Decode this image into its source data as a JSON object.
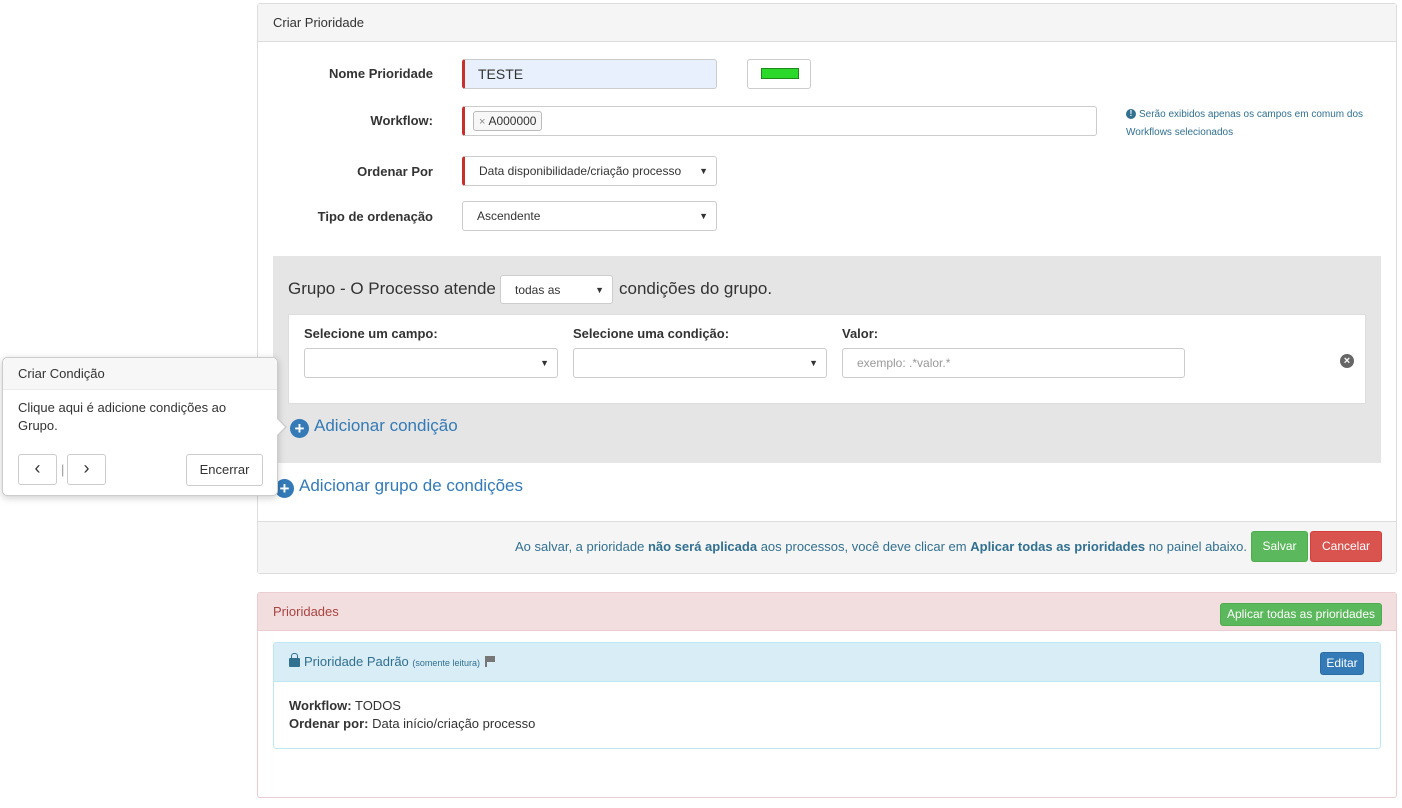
{
  "create_panel": {
    "title": "Criar Prioridade",
    "nome_label": "Nome Prioridade",
    "nome_value": "TESTE",
    "color_value": "#2ad92a",
    "workflow_label": "Workflow:",
    "workflow_tags": [
      "A000000"
    ],
    "workflow_tag_remove": "×",
    "workflow_note": "Serão exibidos apenas os campos em comum dos Workflows selecionados",
    "info_icon_glyph": "!",
    "ordenar_label": "Ordenar Por",
    "ordenar_value": "Data disponibilidade/criação processo",
    "tipo_label": "Tipo de ordenação",
    "tipo_value": "Ascendente",
    "caret_glyph": "▼"
  },
  "group": {
    "prefix": "Grupo - O Processo atende",
    "match_value": "todas as",
    "suffix": "condições do grupo.",
    "campo_label": "Selecione um campo:",
    "campo_value": "",
    "condicao_label": "Selecione uma condição:",
    "condicao_value": "",
    "valor_label": "Valor:",
    "valor_placeholder": "exemplo: .*valor.*",
    "remove_glyph": "×",
    "add_condition": "Adicionar condição",
    "plus_glyph": "+"
  },
  "add_group": "Adicionar grupo de condições",
  "footer": {
    "text_part1": "Ao salvar, a prioridade ",
    "text_bold1": "não será aplicada",
    "text_part2": " aos processos, você deve clicar em ",
    "text_bold2": "Aplicar todas as prioridades",
    "text_part3": " no painel abaixo.",
    "save": "Salvar",
    "cancel": "Cancelar"
  },
  "prioridades": {
    "title": "Prioridades",
    "apply_all": "Aplicar todas as prioridades",
    "item": {
      "name": "Prioridade Padrão",
      "readonly": "(somente leitura)",
      "edit": "Editar",
      "workflow_label": "Workflow:",
      "workflow_value": "TODOS",
      "ordenar_label": "Ordenar por:",
      "ordenar_value": "Data início/criação processo"
    }
  },
  "popover": {
    "title": "Criar Condição",
    "content": "Clique aqui é adicione condições ao Grupo.",
    "prev": "‹",
    "next": "›",
    "sep": "|",
    "end": "Encerrar"
  }
}
